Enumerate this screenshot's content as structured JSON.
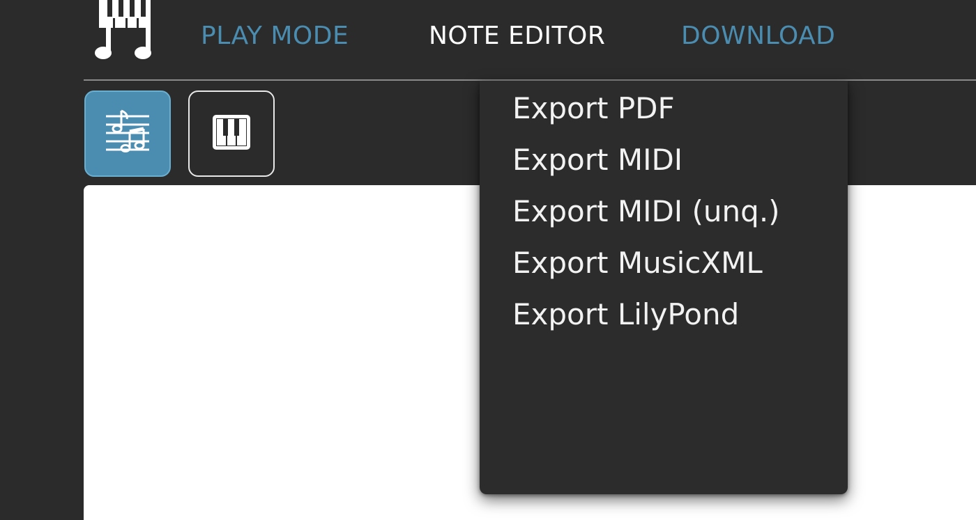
{
  "header": {
    "logo_icon": "music-piano-logo-icon",
    "nav": {
      "play_mode": "PLAY MODE",
      "note_editor": "NOTE EDITOR",
      "download": "DOWNLOAD"
    }
  },
  "toolbar": {
    "score_icon": "sheet-music-icon",
    "piano_icon": "piano-keys-icon"
  },
  "download_menu": {
    "items": [
      "Export PDF",
      "Export MIDI",
      "Export MIDI (unq.)",
      "Export MusicXML",
      "Export LilyPond"
    ]
  },
  "colors": {
    "accent": "#4a8db0",
    "background": "#2b2b2b",
    "menu_background": "#2c2c2c",
    "canvas": "#ffffff",
    "active_nav": "#ffffff"
  }
}
